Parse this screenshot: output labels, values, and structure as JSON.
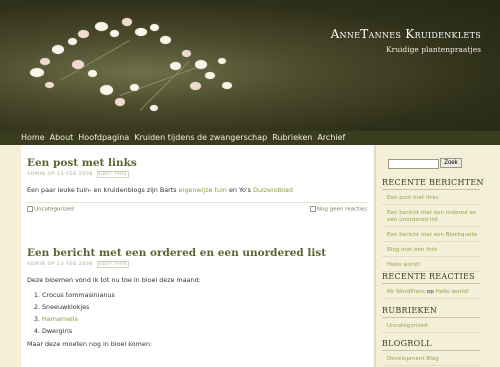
{
  "header": {
    "title": "AnneTannes Kruidenklets",
    "description": "Kruidige plantenpraatjes"
  },
  "nav": {
    "items": [
      "Home",
      "About",
      "Hoofdpagina",
      "Kruiden tijdens de zwangerschap",
      "Rubrieken",
      "Archief"
    ]
  },
  "posts": [
    {
      "title": "Een post met links",
      "meta": "admin op 13 Feb 2008",
      "edit": "Edit This",
      "body_before": "Een paar leuke tuin- en kruidenblogs zijn Barts ",
      "link1": "eigenwijze tuin",
      "body_middle": " en Yo's ",
      "link2": "Duizendblad",
      "tag": "Uncategorized",
      "comments": "Nog geen reacties"
    },
    {
      "title": "Een bericht met een ordered en een unordered list",
      "meta": "admin op 13 Feb 2008",
      "edit": "Edit This",
      "intro": "Deze bloemen vond ik tot nu toe in bloei deze maand:",
      "list": [
        "Crocus tommasinianus",
        "Sneeuwklokjes",
        "Hamamelis",
        "Dwergiris"
      ],
      "outro": "Maar deze moeten nog in bloei komen:"
    }
  ],
  "sidebar": {
    "search_button": "Zoek",
    "recent_posts": {
      "title": "Recente berichten",
      "items": [
        "Een post met links",
        "Een bericht met een ordered en een unordered list",
        "Een bericht met een Blockquote",
        "Blog met een foto",
        "Hello world!"
      ]
    },
    "recent_comments": {
      "title": "Recente reacties",
      "author": "Mr WordPress",
      "connector": "op",
      "post": "Hello world!"
    },
    "categories": {
      "title": "Rubrieken",
      "items": [
        "Uncategorized"
      ]
    },
    "blogroll": {
      "title": "Blogroll",
      "items": [
        "Development Blog"
      ]
    }
  }
}
